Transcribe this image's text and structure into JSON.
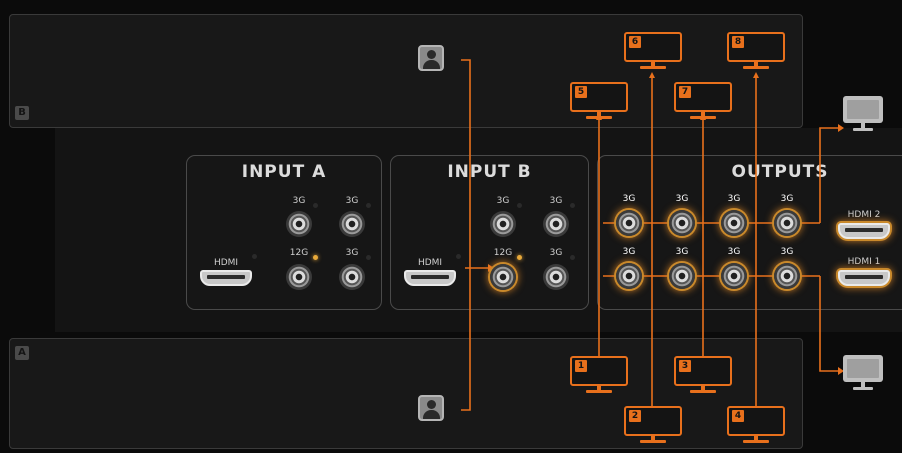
{
  "colors": {
    "accent": "#e8701c",
    "panel": "#181818",
    "background": "#0b0b0b"
  },
  "panels": {
    "b": {
      "badge": "B"
    },
    "a": {
      "badge": "A"
    }
  },
  "input_a": {
    "title": "INPUT A",
    "ports": [
      {
        "label": "3G",
        "led": "off"
      },
      {
        "label": "3G",
        "led": "off"
      },
      {
        "label": "12G",
        "led": "on"
      },
      {
        "label": "3G",
        "led": "off"
      }
    ],
    "hdmi_label": "HDMI"
  },
  "input_b": {
    "title": "INPUT B",
    "ports": [
      {
        "label": "3G",
        "led": "off"
      },
      {
        "label": "3G",
        "led": "off"
      },
      {
        "label": "12G",
        "led": "on"
      },
      {
        "label": "3G",
        "led": "off"
      }
    ],
    "hdmi_label": "HDMI"
  },
  "outputs": {
    "title": "OUTPUTS",
    "top_row": [
      "3G",
      "3G",
      "3G",
      "3G"
    ],
    "bottom_row": [
      "3G",
      "3G",
      "3G",
      "3G"
    ],
    "hdmi_top": "HDMI 2",
    "hdmi_bottom": "HDMI 1"
  },
  "monitors": [
    "1",
    "2",
    "3",
    "4",
    "5",
    "6",
    "7",
    "8"
  ],
  "icons": {
    "user": "user-icon",
    "monitor": "monitor-icon",
    "hdmi": "hdmi-port-icon",
    "bnc": "bnc-connector-icon"
  }
}
